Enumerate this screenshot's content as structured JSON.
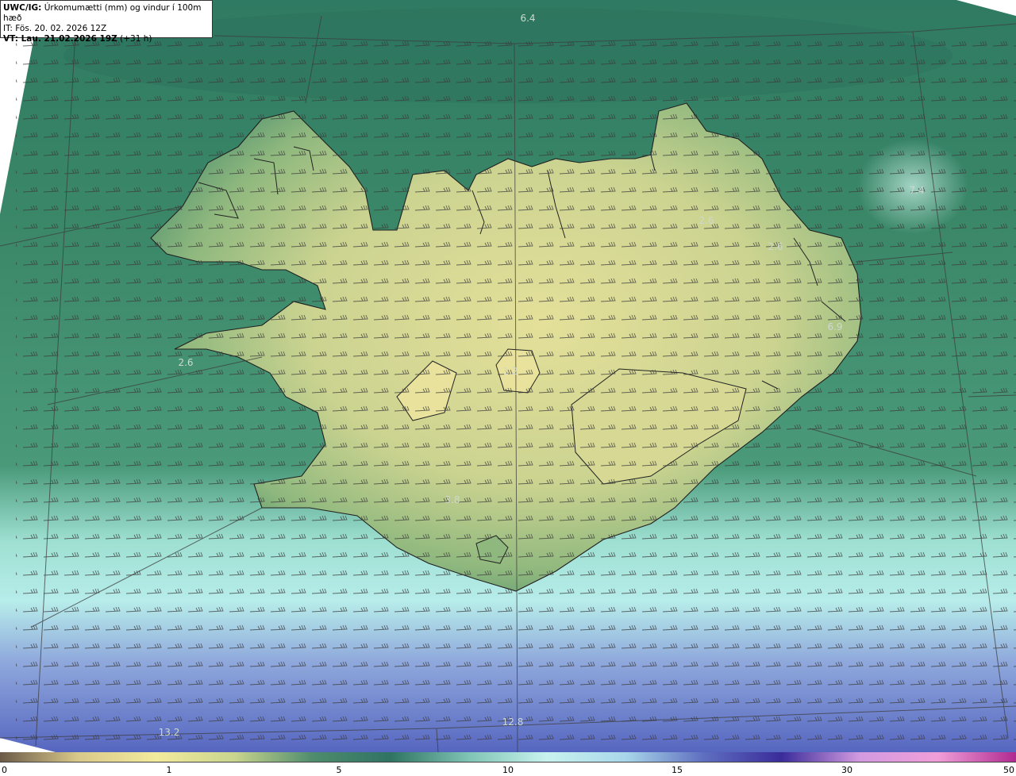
{
  "header": {
    "model_label": "UWC/IG:",
    "product": "Úrkomumætti (mm) og vindur í 100m hæð",
    "issue_time": "IT: Fös. 20. 02. 2026 12Z",
    "valid_label": "VT: Lau. 21.02.2026 19Z",
    "lead_time": "(+31 h)"
  },
  "map_values": [
    {
      "id": "value-north",
      "text": "6.4"
    },
    {
      "id": "value-northeast-sea",
      "text": "7.4"
    },
    {
      "id": "value-northeast-1",
      "text": "2.6"
    },
    {
      "id": "value-northeast-2",
      "text": "2.6"
    },
    {
      "id": "value-eastfjords",
      "text": "6.9"
    },
    {
      "id": "value-west",
      "text": "2.6"
    },
    {
      "id": "value-central",
      "text": "1.2"
    },
    {
      "id": "value-south",
      "text": "3.8"
    },
    {
      "id": "value-southwest-sea",
      "text": "13.2"
    },
    {
      "id": "value-south-sea",
      "text": "12.8"
    }
  ],
  "colorbar": {
    "ticks": [
      "0",
      "1",
      "5",
      "10",
      "15",
      "30",
      "50"
    ],
    "colors": [
      "#6b5a48",
      "#d9c98a",
      "#f2ea9c",
      "#c9d58e",
      "#4f8c6e",
      "#2f7363",
      "#7fc4b4",
      "#c8f2ee",
      "#a9d7ea",
      "#5f6fc0",
      "#3a2c9a",
      "#d39ae0",
      "#f09ed8",
      "#b02a90"
    ]
  }
}
